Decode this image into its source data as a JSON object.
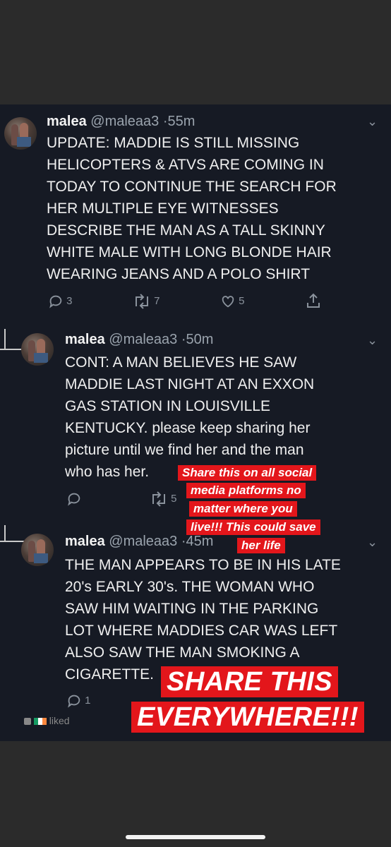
{
  "tweets": [
    {
      "name": "malea",
      "handle": "@maleaa3",
      "time": "55m",
      "lines": [
        "UPDATE: MADDIE IS STILL MISSING",
        "HELICOPTERS & ATVS ARE COMING IN",
        "TODAY TO CONTINUE THE SEARCH FOR",
        "HER MULTIPLE EYE WITNESSES",
        "DESCRIBE THE MAN AS A TALL SKINNY",
        "WHITE MALE WITH LONG BLONDE HAIR",
        "WEARING JEANS AND A POLO SHIRT"
      ],
      "replies": "3",
      "retweets": "7",
      "likes": "5"
    },
    {
      "name": "malea",
      "handle": "@maleaa3",
      "time": "50m",
      "lines": [
        "CONT: A MAN BELIEVES HE SAW",
        "MADDIE LAST NIGHT AT AN EXXON",
        "GAS STATION IN LOUISVILLE",
        "KENTUCKY. please keep sharing her",
        "picture until we find her and the man",
        "who has her."
      ],
      "retweets": "5"
    },
    {
      "name": "malea",
      "handle": "@maleaa3",
      "time": "45m",
      "lines": [
        "THE MAN APPEARS TO BE IN HIS LATE",
        "20's EARLY 30's. THE WOMAN WHO",
        "SAW HIM WAITING IN THE PARKING",
        "LOT WHERE MADDIES CAR WAS LEFT",
        "ALSO SAW THE MAN SMOKING A",
        "CIGARETTE."
      ],
      "replies": "1"
    }
  ],
  "overlay_small": [
    "Share this on all social",
    "media platforms no",
    "matter where you",
    "live!!! This could save",
    "her life"
  ],
  "overlay_big": [
    "SHARE THIS",
    "EVERYWHERE!!!"
  ],
  "footer": {
    "liked_text": "liked"
  },
  "colors": {
    "background": "#161a24",
    "overlay_red": "#e3161b",
    "text": "#efefef",
    "muted": "#8a929c"
  }
}
